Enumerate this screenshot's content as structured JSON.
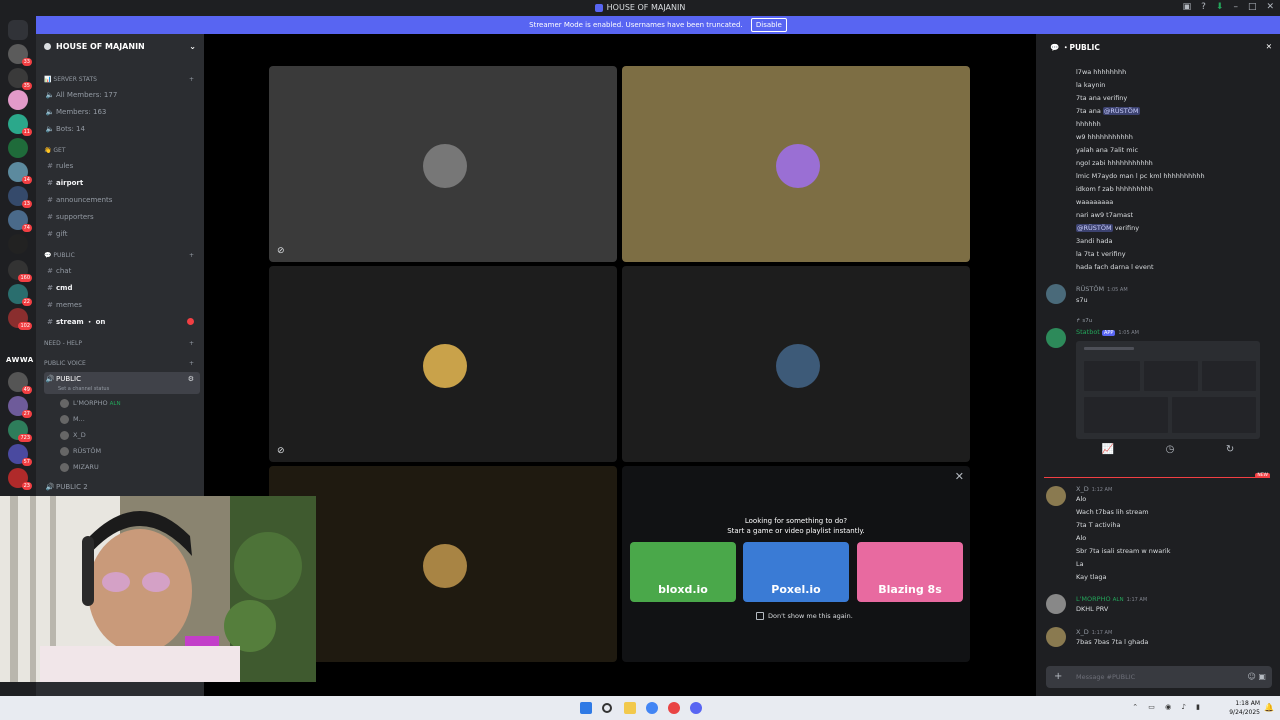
{
  "window": {
    "title": "HOUSE OF MAJANIN"
  },
  "banner": {
    "text": "Streamer Mode is enabled. Usernames have been truncated.",
    "button": "Disable"
  },
  "guild_badges": [
    "33",
    "35",
    "11",
    "14",
    "13",
    "74",
    "160",
    "22",
    "102",
    "49",
    "27",
    "723",
    "57",
    "23"
  ],
  "guild_label": "AWWA",
  "server": {
    "name": "HOUSE OF MAJANIN",
    "stats_category": "SERVER STATS",
    "stats": [
      "All Members: 177",
      "Members: 163",
      "Bots: 14"
    ],
    "get_category": "GET",
    "get_channels": [
      "rules",
      "airport",
      "announcements",
      "supporters",
      "gift"
    ],
    "public_category": "PUBLIC",
    "public_channels": [
      "chat",
      "cmd",
      "memes",
      "stream ・ on"
    ],
    "help_category": "NEED - HELP",
    "voice_category": "PUBLIC VOICE",
    "voice_channel": "PUBLIC",
    "voice_status": "Set a channel status",
    "voice_users": [
      "L'MORPHO",
      "M...",
      "X_D",
      "RÜSTÖM",
      "MIZARU"
    ],
    "voice_tag": "ALN",
    "voice_channel2": "PUBLIC 2"
  },
  "activity": {
    "title": "Looking for something to do?",
    "subtitle": "Start a game or video playlist instantly.",
    "games": [
      "bloxd.io",
      "Poxel.io",
      "Blazing 8s"
    ],
    "checkbox": "Don't show me this again."
  },
  "chat": {
    "channel": "PUBLIC",
    "lines": [
      "l7wa hhhhhhhh",
      "la kaynin",
      "7ta ana verifiny",
      "7ta ana",
      "hhhhhh",
      "w9 hhhhhhhhhhh",
      "yalah ana 7alit mic",
      "ngol zabi hhhhhhhhhhh",
      "lmic M7aydo man l pc kml hhhhhhhhhh",
      "idkom f zab hhhhhhhhh",
      "waaaaaaaa",
      "nari aw9 t7amast",
      "verifiny",
      "3andi hada",
      "la 7ta t verifiny",
      "hada fach darna l event"
    ],
    "mention": "@RÜSTÖM",
    "msg2": {
      "user": "RÜSTÖM",
      "time": "1:05 AM",
      "text": "s7u"
    },
    "reply": "s7u",
    "statbot": {
      "user": "Statbot",
      "tag": "APP",
      "time": "1:05 AM"
    },
    "new_label": "NEW",
    "msg3": {
      "user": "X_D",
      "time": "1:12 AM",
      "lines": [
        "Alo",
        "Wach t7bas lih stream",
        "7ta T activiha",
        "Alo",
        "Sbr 7ta isali stream w nwarik",
        "La",
        "Kay tlaga"
      ]
    },
    "msg4": {
      "user": "L'MORPHO",
      "tag": "ALN",
      "time": "1:17 AM",
      "text": "DKHL PRV"
    },
    "msg5": {
      "user": "X_D",
      "time": "1:17 AM",
      "text": "7bas 7bas 7ta l ghada"
    },
    "input_placeholder": "Message #PUBLIC"
  },
  "taskbar": {
    "time": "1:18 AM",
    "date": "9/24/2025"
  }
}
